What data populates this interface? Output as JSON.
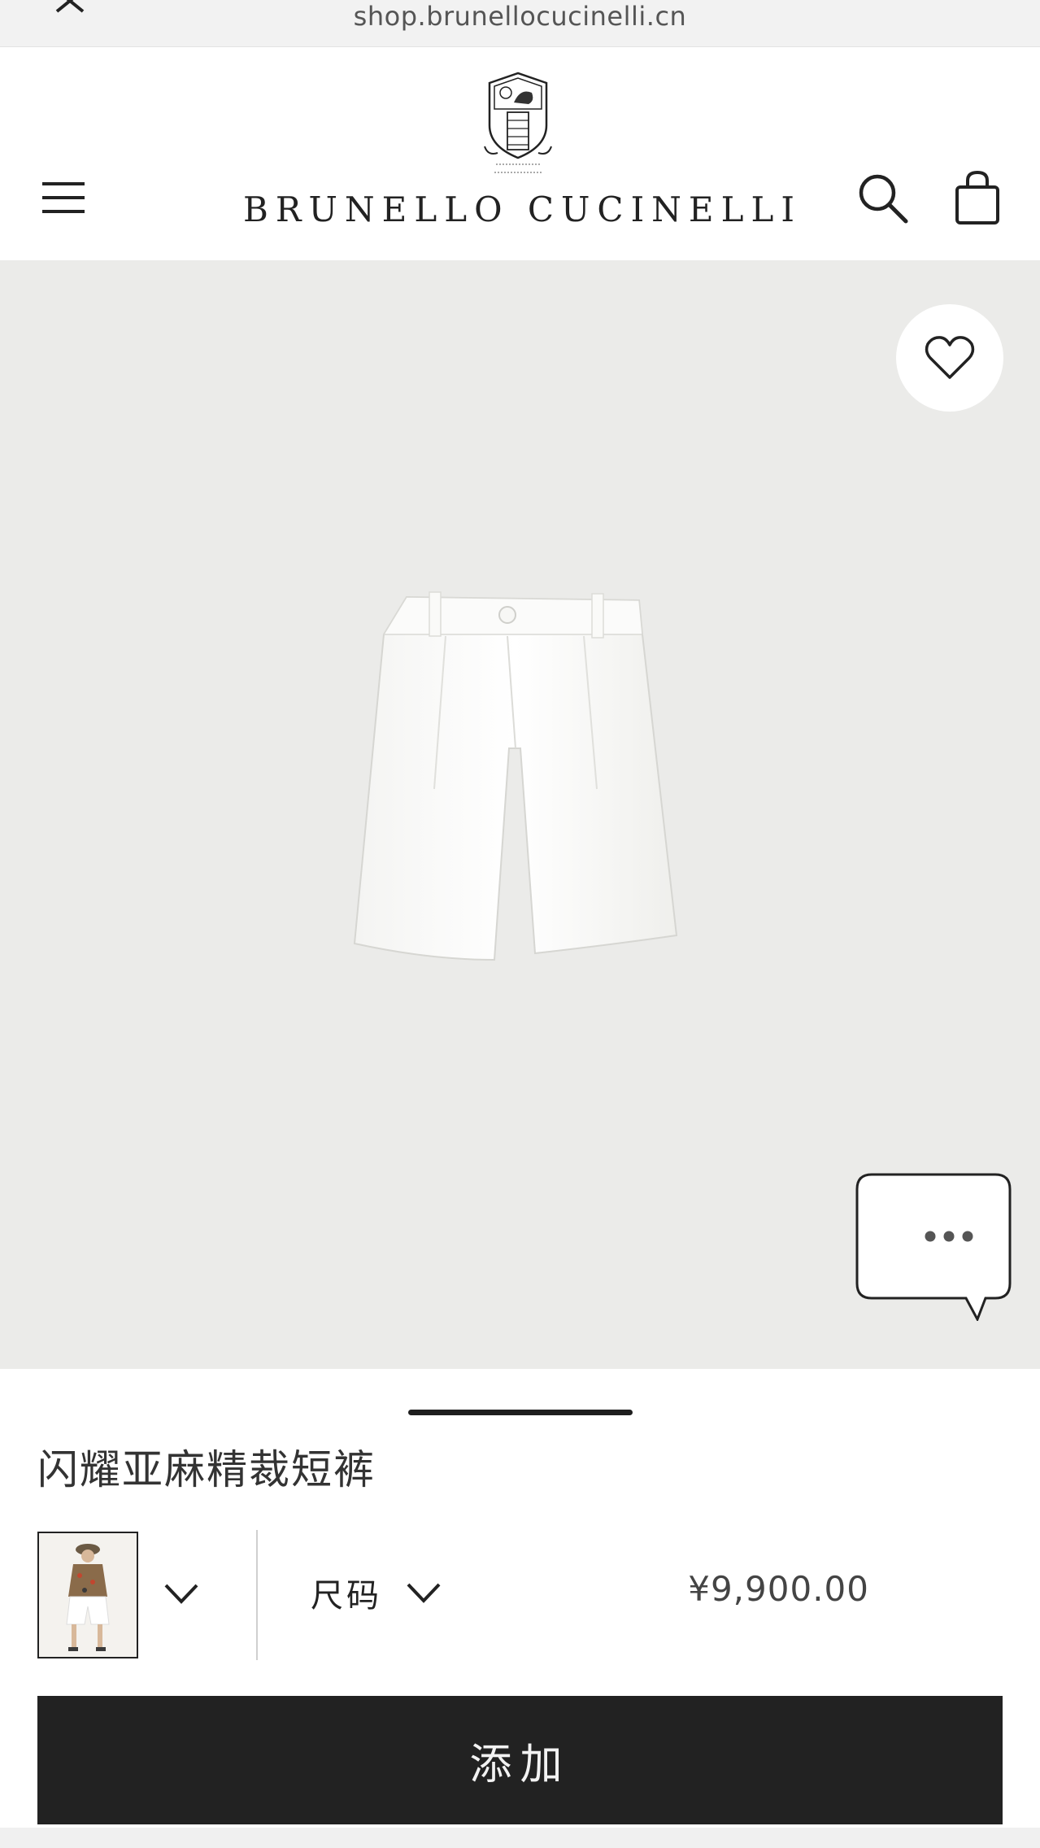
{
  "browser": {
    "url": "shop.brunellocucinelli.cn",
    "close_icon": "close-icon"
  },
  "header": {
    "brand": "BRUNELLO CUCINELLI",
    "menu_icon": "hamburger-menu-icon",
    "search_icon": "search-icon",
    "bag_icon": "shopping-bag-icon",
    "crest_icon": "brand-crest-logo"
  },
  "product": {
    "image_subject": "white-linen-shorts",
    "favorite_icon": "heart-icon",
    "chat_icon": "chat-bubble-icon"
  },
  "details": {
    "title": "闪耀亚麻精裁短裤",
    "size_label": "尺码",
    "price": "¥9,900.00",
    "add_button_label": "添加"
  },
  "colors": {
    "hero_background": "#ebebe9",
    "button_background": "#222222",
    "button_text": "#f2f2f2"
  }
}
